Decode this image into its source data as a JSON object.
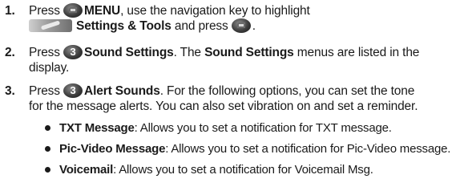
{
  "steps": [
    {
      "number": "1.",
      "press": "Press",
      "menu_label": "MENU",
      "after_menu": ", use the navigation key to highlight",
      "settings_label": "Settings & Tools",
      "and_press": " and press",
      "end": "."
    },
    {
      "number": "2.",
      "press": "Press",
      "key": "3",
      "bold_label": "Sound Settings",
      "rest_1": ". The ",
      "bold_label_2": "Sound Settings",
      "rest_2": " menus are listed in the",
      "line2": "display."
    },
    {
      "number": "3.",
      "press": "Press",
      "key": "3",
      "bold_label": "Alert Sounds",
      "rest_1": ". For the following options, you can set the tone",
      "line2": "for the message alerts. You can also set vibration on and set a reminder."
    }
  ],
  "options": [
    {
      "term": "TXT Message",
      "desc": ": Allows you to set a notification for TXT message."
    },
    {
      "term": "Pic-Video Message",
      "desc": ": Allows you to set a notification for Pic-Video message."
    },
    {
      "term": "Voicemail",
      "desc": ": Allows you to set a notification for Voicemail Msg."
    }
  ],
  "icons": {
    "menu_key": "menu-ok-key-icon",
    "settings_tools": "settings-tools-icon",
    "digit_key": "number-key-icon"
  }
}
